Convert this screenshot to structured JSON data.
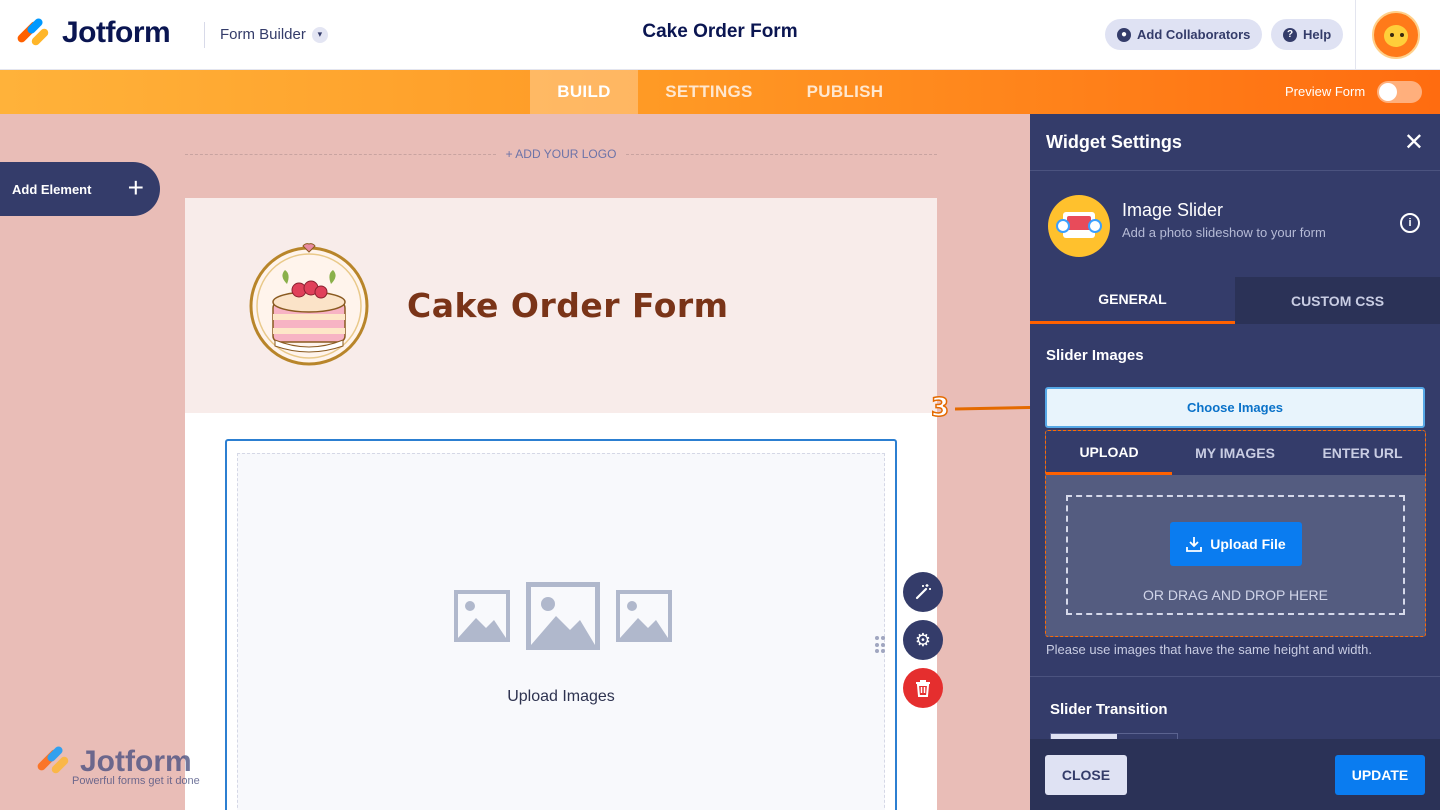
{
  "app": {
    "brand": "Jotform",
    "builder_menu": "Form Builder",
    "form_title": "Cake Order Form",
    "add_collaborators": "Add Collaborators",
    "help": "Help"
  },
  "nav": {
    "tabs": [
      "BUILD",
      "SETTINGS",
      "PUBLISH"
    ],
    "active": "BUILD",
    "preview_label": "Preview Form",
    "preview_on": false
  },
  "canvas": {
    "add_logo": "+ ADD YOUR LOGO",
    "add_element": "Add Element",
    "form_header_title": "Cake Order Form",
    "widget_placeholder": "Upload Images"
  },
  "watermark": {
    "brand": "Jotform",
    "tagline": "Powerful forms get it done"
  },
  "annotation": {
    "step": "3"
  },
  "panel": {
    "title": "Widget Settings",
    "widget_name": "Image Slider",
    "widget_desc": "Add a photo slideshow to your form",
    "tabs": [
      "GENERAL",
      "CUSTOM CSS"
    ],
    "active_tab": "GENERAL",
    "slider_images_label": "Slider Images",
    "choose_images": "Choose Images",
    "upload_tabs": [
      "UPLOAD",
      "MY IMAGES",
      "ENTER URL"
    ],
    "upload_file": "Upload File",
    "drag_drop": "OR DRAG AND DROP HERE",
    "hint": "Please use images that have the same height and width.",
    "slider_transition_label": "Slider Transition",
    "close": "CLOSE",
    "update": "UPDATE"
  },
  "colors": {
    "brand_orange": "#ff6100",
    "brand_navy": "#0a1551",
    "panel_bg": "#343c6a",
    "primary_blue": "#0a7cf0",
    "canvas_bg": "#e9bdb7"
  }
}
